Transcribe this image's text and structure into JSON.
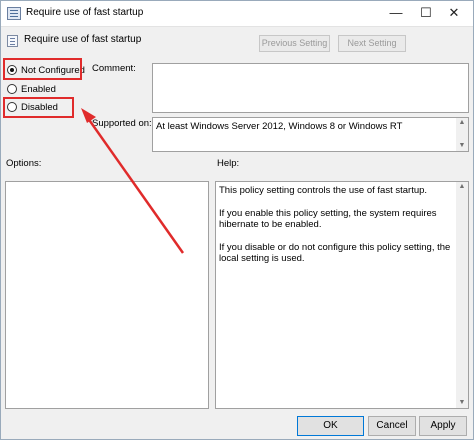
{
  "window": {
    "title": "Require use of fast startup",
    "controls": {
      "minimize": "—",
      "maximize": "☐",
      "close": "✕"
    }
  },
  "header": {
    "policy_title": "Require use of fast startup",
    "previous_label": "Previous Setting",
    "next_label": "Next Setting"
  },
  "state": {
    "options": [
      {
        "label": "Not Configured",
        "selected": true
      },
      {
        "label": "Enabled",
        "selected": false
      },
      {
        "label": "Disabled",
        "selected": false
      }
    ]
  },
  "fields": {
    "comment_label": "Comment:",
    "comment_value": "",
    "supported_label": "Supported on:",
    "supported_value": "At least Windows Server 2012, Windows 8 or Windows RT"
  },
  "panes": {
    "options_label": "Options:",
    "help_label": "Help:",
    "help_paragraphs": [
      "This policy setting controls the use of fast startup.",
      "If you enable this policy setting, the system requires hibernate to be enabled.",
      "If you disable or do not configure this policy setting, the local setting is used."
    ]
  },
  "buttons": {
    "ok": "OK",
    "cancel": "Cancel",
    "apply": "Apply"
  },
  "annotation": {
    "highlight_color": "#e02b2b"
  }
}
